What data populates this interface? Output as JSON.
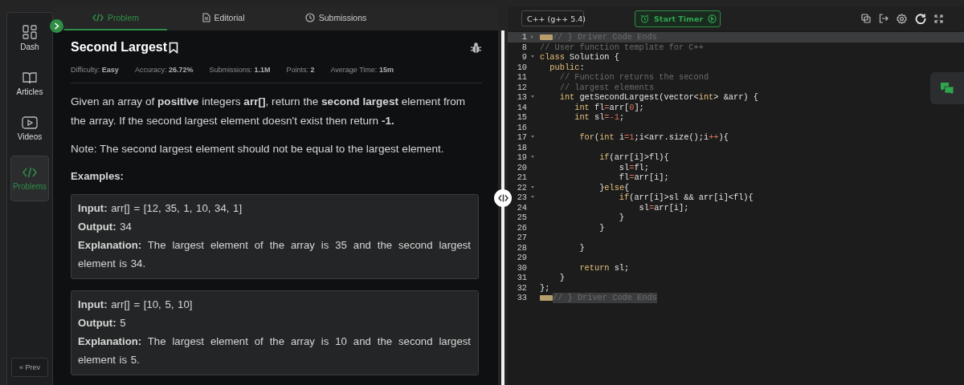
{
  "sidebar": {
    "items": [
      {
        "label": "Dash",
        "selected": false
      },
      {
        "label": "Articles",
        "selected": false
      },
      {
        "label": "Videos",
        "selected": false
      },
      {
        "label": "Problems",
        "selected": true
      }
    ],
    "prev_button": "« Prev"
  },
  "tabs": [
    {
      "label": "Problem",
      "selected": true
    },
    {
      "label": "Editorial",
      "selected": false
    },
    {
      "label": "Submissions",
      "selected": false
    }
  ],
  "problem": {
    "title": "Second Largest",
    "bookmarked": false,
    "meta": [
      {
        "label": "Difficulty:",
        "value": "Easy"
      },
      {
        "label": "Accuracy:",
        "value": "26.72%"
      },
      {
        "label": "Submissions:",
        "value": "1.1M"
      },
      {
        "label": "Points:",
        "value": "2"
      },
      {
        "label": "Average Time:",
        "value": "15m"
      }
    ],
    "paragraphs": [
      "Given an array of **positive** integers **arr[]**, return the **second largest** element from the array. If the second largest element doesn't exist then return **-1.**",
      "Note: The second largest element should not be equal to the largest element."
    ],
    "examples_heading": "Examples:",
    "examples": [
      [
        "**Input:** arr[] = [12, 35, 1, 10, 34, 1]",
        "**Output:** 34",
        "**Explanation:** The largest element of the array is 35 and the second largest element is 34."
      ],
      [
        "**Input:** arr[] = [10, 5, 10]",
        "**Output:** 5",
        "**Explanation:** The largest element of the array is 10 and the second largest element is 5."
      ]
    ]
  },
  "editor": {
    "language": "C++ (g++ 5.4)",
    "timer_button": "Start Timer",
    "lines": [
      {
        "number": "1",
        "folded": true,
        "collapsed_marker": true,
        "active": true,
        "tokens": [
          {
            "kind": "comment",
            "text": "// } Driver Code Ends"
          }
        ]
      },
      {
        "number": "8",
        "tokens": [
          {
            "kind": "comment",
            "text": "// User function template for C++"
          }
        ]
      },
      {
        "number": "9",
        "folded": false,
        "tokens": [
          {
            "kind": "keyword",
            "text": "class"
          },
          {
            "kind": "plain",
            "text": " Solution {"
          }
        ]
      },
      {
        "number": "10",
        "tokens": [
          {
            "kind": "keyword",
            "text": "  public"
          },
          {
            "kind": "plain",
            "text": ":"
          }
        ]
      },
      {
        "number": "11",
        "tokens": [
          {
            "kind": "comment",
            "text": "    // Function returns the second"
          }
        ]
      },
      {
        "number": "12",
        "tokens": [
          {
            "kind": "comment",
            "text": "    // largest elements"
          }
        ]
      },
      {
        "number": "13",
        "folded": false,
        "tokens": [
          {
            "kind": "keyword",
            "text": "    int"
          },
          {
            "kind": "plain",
            "text": " getSecondLargest(vector<"
          },
          {
            "kind": "keyword",
            "text": "int"
          },
          {
            "kind": "plain",
            "text": "> &arr) {"
          }
        ]
      },
      {
        "number": "14",
        "tokens": [
          {
            "kind": "keyword",
            "text": "       int"
          },
          {
            "kind": "plain",
            "text": " fl"
          },
          {
            "kind": "operator",
            "text": "="
          },
          {
            "kind": "plain",
            "text": "arr["
          },
          {
            "kind": "number",
            "text": "0"
          },
          {
            "kind": "plain",
            "text": "];"
          }
        ]
      },
      {
        "number": "15",
        "tokens": [
          {
            "kind": "keyword",
            "text": "       int"
          },
          {
            "kind": "plain",
            "text": " sl"
          },
          {
            "kind": "operator",
            "text": "="
          },
          {
            "kind": "number",
            "text": "-1"
          },
          {
            "kind": "plain",
            "text": ";"
          }
        ]
      },
      {
        "number": "16"
      },
      {
        "number": "17",
        "folded": false,
        "tokens": [
          {
            "kind": "keyword",
            "text": "        for"
          },
          {
            "kind": "plain",
            "text": "("
          },
          {
            "kind": "keyword",
            "text": "int"
          },
          {
            "kind": "plain",
            "text": " i"
          },
          {
            "kind": "operator",
            "text": "="
          },
          {
            "kind": "number",
            "text": "1"
          },
          {
            "kind": "plain",
            "text": ";i<arr.size();i"
          },
          {
            "kind": "operator",
            "text": "++"
          },
          {
            "kind": "plain",
            "text": "){"
          }
        ]
      },
      {
        "number": "18"
      },
      {
        "number": "19",
        "folded": false,
        "tokens": [
          {
            "kind": "keyword",
            "text": "            if"
          },
          {
            "kind": "plain",
            "text": "(arr[i]>fl){"
          }
        ]
      },
      {
        "number": "20",
        "tokens": [
          {
            "kind": "plain",
            "text": "                sl"
          },
          {
            "kind": "operator",
            "text": "="
          },
          {
            "kind": "plain",
            "text": "fl;"
          }
        ]
      },
      {
        "number": "21",
        "tokens": [
          {
            "kind": "plain",
            "text": "                fl"
          },
          {
            "kind": "operator",
            "text": "="
          },
          {
            "kind": "plain",
            "text": "arr[i];"
          }
        ]
      },
      {
        "number": "22",
        "folded": false,
        "tokens": [
          {
            "kind": "plain",
            "text": "            }"
          },
          {
            "kind": "keyword",
            "text": "else"
          },
          {
            "kind": "plain",
            "text": "{"
          }
        ]
      },
      {
        "number": "23",
        "folded": false,
        "tokens": [
          {
            "kind": "keyword",
            "text": "                if"
          },
          {
            "kind": "plain",
            "text": "(arr[i]>sl && arr[i]<fl){"
          }
        ]
      },
      {
        "number": "24",
        "tokens": [
          {
            "kind": "plain",
            "text": "                    sl"
          },
          {
            "kind": "operator",
            "text": "="
          },
          {
            "kind": "plain",
            "text": "arr[i];"
          }
        ]
      },
      {
        "number": "25",
        "tokens": [
          {
            "kind": "plain",
            "text": "                }"
          }
        ]
      },
      {
        "number": "26",
        "tokens": [
          {
            "kind": "plain",
            "text": "            }"
          }
        ]
      },
      {
        "number": "27"
      },
      {
        "number": "28",
        "tokens": [
          {
            "kind": "plain",
            "text": "        }"
          }
        ]
      },
      {
        "number": "29"
      },
      {
        "number": "30",
        "tokens": [
          {
            "kind": "keyword",
            "text": "        return"
          },
          {
            "kind": "plain",
            "text": " sl;"
          }
        ]
      },
      {
        "number": "31",
        "tokens": [
          {
            "kind": "plain",
            "text": "    }"
          }
        ]
      },
      {
        "number": "32",
        "tokens": [
          {
            "kind": "plain",
            "text": "};"
          }
        ]
      },
      {
        "number": "33",
        "collapsed_marker": true,
        "tokens": [
          {
            "kind": "comment",
            "text": "// } Driver Code Ends"
          }
        ]
      }
    ]
  }
}
